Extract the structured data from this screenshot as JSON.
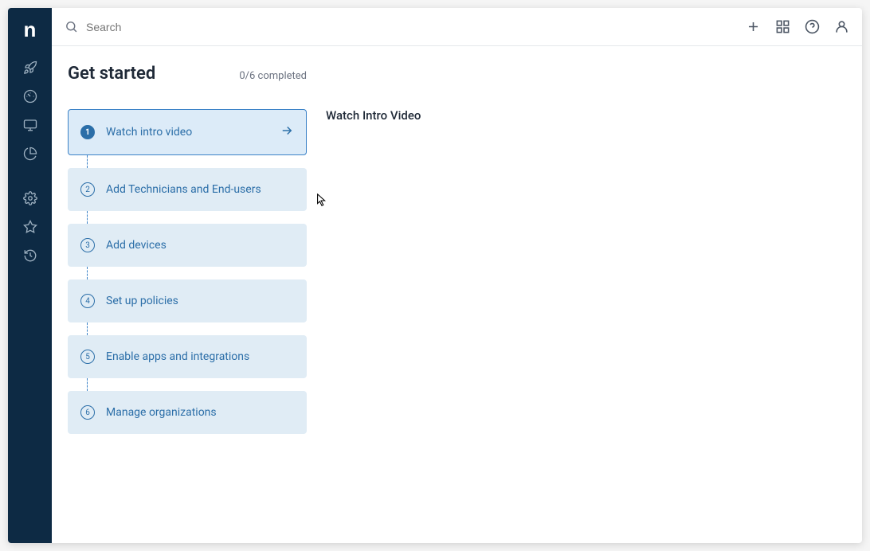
{
  "app": {
    "logo": "n"
  },
  "search": {
    "placeholder": "Search"
  },
  "page": {
    "title": "Get started",
    "progress": "0/6 completed"
  },
  "steps": [
    {
      "num": "1",
      "label": "Watch intro video",
      "active": true
    },
    {
      "num": "2",
      "label": "Add Technicians and End-users",
      "active": false
    },
    {
      "num": "3",
      "label": "Add devices",
      "active": false
    },
    {
      "num": "4",
      "label": "Set up policies",
      "active": false
    },
    {
      "num": "5",
      "label": "Enable apps and integrations",
      "active": false
    },
    {
      "num": "6",
      "label": "Manage organizations",
      "active": false
    }
  ],
  "detail": {
    "title": "Watch Intro Video"
  }
}
